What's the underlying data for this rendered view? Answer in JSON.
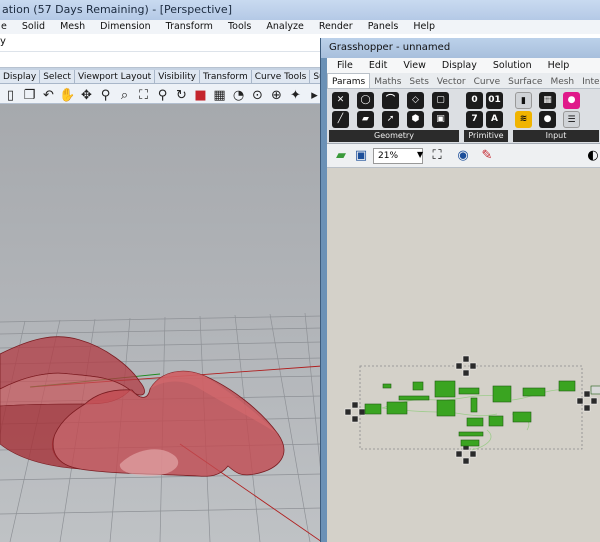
{
  "rhino": {
    "title": "ation (57 Days Remaining) - [Perspective]",
    "menu": [
      "e",
      "Solid",
      "Mesh",
      "Dimension",
      "Transform",
      "Tools",
      "Analyze",
      "Render",
      "Panels",
      "Help"
    ],
    "command_prompt": "y",
    "command_input": "",
    "toolbar_tabs": [
      "Display",
      "Select",
      "Viewport Layout",
      "Visibility",
      "Transform",
      "Curve Tools",
      "Surface Tools"
    ],
    "toolbar_icons": [
      "clipboard-icon",
      "copy-icon",
      "undo-icon",
      "pan-icon",
      "rotate-icon",
      "zoom-icon",
      "zoom-window-icon",
      "zoom-extents-icon",
      "zoom-selected-icon",
      "rotate-view-icon",
      "car-icon",
      "grid-icon",
      "named-view-icon",
      "set-cplane-icon",
      "cplane-icon",
      "light-icon",
      "more-icon"
    ],
    "viewport": {
      "name": "Perspective",
      "surface_color": "#b23a41",
      "grid_color": "#8e9196"
    }
  },
  "grasshopper": {
    "title": "Grasshopper - unnamed",
    "menu": [
      "File",
      "Edit",
      "View",
      "Display",
      "Solution",
      "Help"
    ],
    "tabs": [
      "Params",
      "Maths",
      "Sets",
      "Vector",
      "Curve",
      "Surface",
      "Mesh",
      "Intersect"
    ],
    "active_tab": "Params",
    "ribbon_groups": [
      {
        "label": "Geometry"
      },
      {
        "label": "Primitive"
      },
      {
        "label": "Input"
      }
    ],
    "zoom": "21%",
    "canvas_color": "#d4d1c9",
    "component_color": "#3aa421"
  }
}
